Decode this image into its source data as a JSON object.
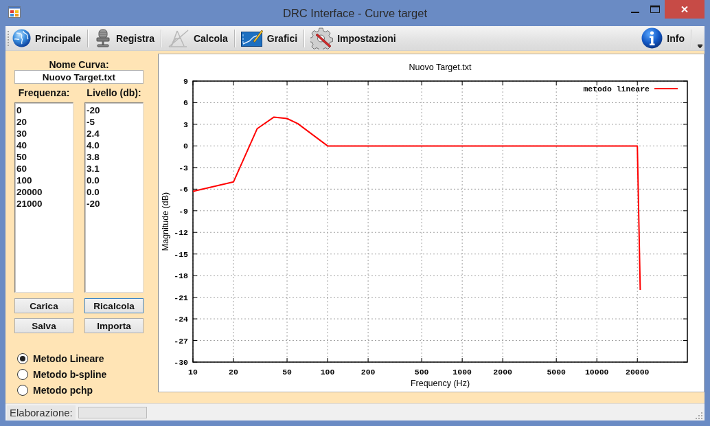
{
  "window": {
    "title": "DRC Interface - Curve target"
  },
  "toolbar": {
    "items": [
      "Principale",
      "Registra",
      "Calcola",
      "Grafici",
      "Impostazioni"
    ],
    "right_items": [
      "Info"
    ]
  },
  "curve_panel": {
    "name_label": "Nome Curva:",
    "name_value": "Nuovo Target.txt",
    "lists": [
      {
        "label": "Frequenza:",
        "items": [
          "0",
          "20",
          "30",
          "40",
          "50",
          "60",
          "100",
          "20000",
          "21000"
        ]
      },
      {
        "label": "Livello (db):",
        "items": [
          "-20",
          "-5",
          "2.4",
          "4.0",
          "3.8",
          "3.1",
          "0.0",
          "0.0",
          "-20"
        ]
      }
    ],
    "buttons": [
      {
        "label": "Carica",
        "focused": false
      },
      {
        "label": "Ricalcola",
        "focused": true
      },
      {
        "label": "Salva",
        "focused": false
      },
      {
        "label": "Importa",
        "focused": false
      }
    ],
    "methods": [
      {
        "label": "Metodo Lineare",
        "selected": true
      },
      {
        "label": "Metodo b-spline",
        "selected": false
      },
      {
        "label": "Metodo pchp",
        "selected": false
      }
    ]
  },
  "chart": {
    "chart_data": {
      "type": "line",
      "title": "Nuovo Target.txt",
      "xlabel": "Frequency (Hz)",
      "ylabel": "Magnitude (dB)",
      "log": "x",
      "x": [
        10,
        20,
        30,
        40,
        50,
        60,
        100,
        20000,
        21000
      ],
      "series": [
        {
          "name": "metodo lineare",
          "color": "#ff0000",
          "values": [
            -6.3,
            -5,
            2.4,
            4,
            3.8,
            3.1,
            0,
            0,
            -20
          ]
        }
      ],
      "xlim": [
        10,
        47000
      ],
      "ylim": [
        -30,
        9
      ],
      "xticks": [
        10,
        20,
        50,
        100,
        200,
        500,
        1000,
        2000,
        5000,
        10000,
        20000
      ],
      "yticks": [
        9,
        6,
        3,
        0,
        -3,
        -6,
        -9,
        -12,
        -15,
        -18,
        -21,
        -24,
        -27,
        -30
      ],
      "grid": true,
      "legend": "top right"
    }
  },
  "status_bar": {
    "label": "Elaborazione:"
  }
}
